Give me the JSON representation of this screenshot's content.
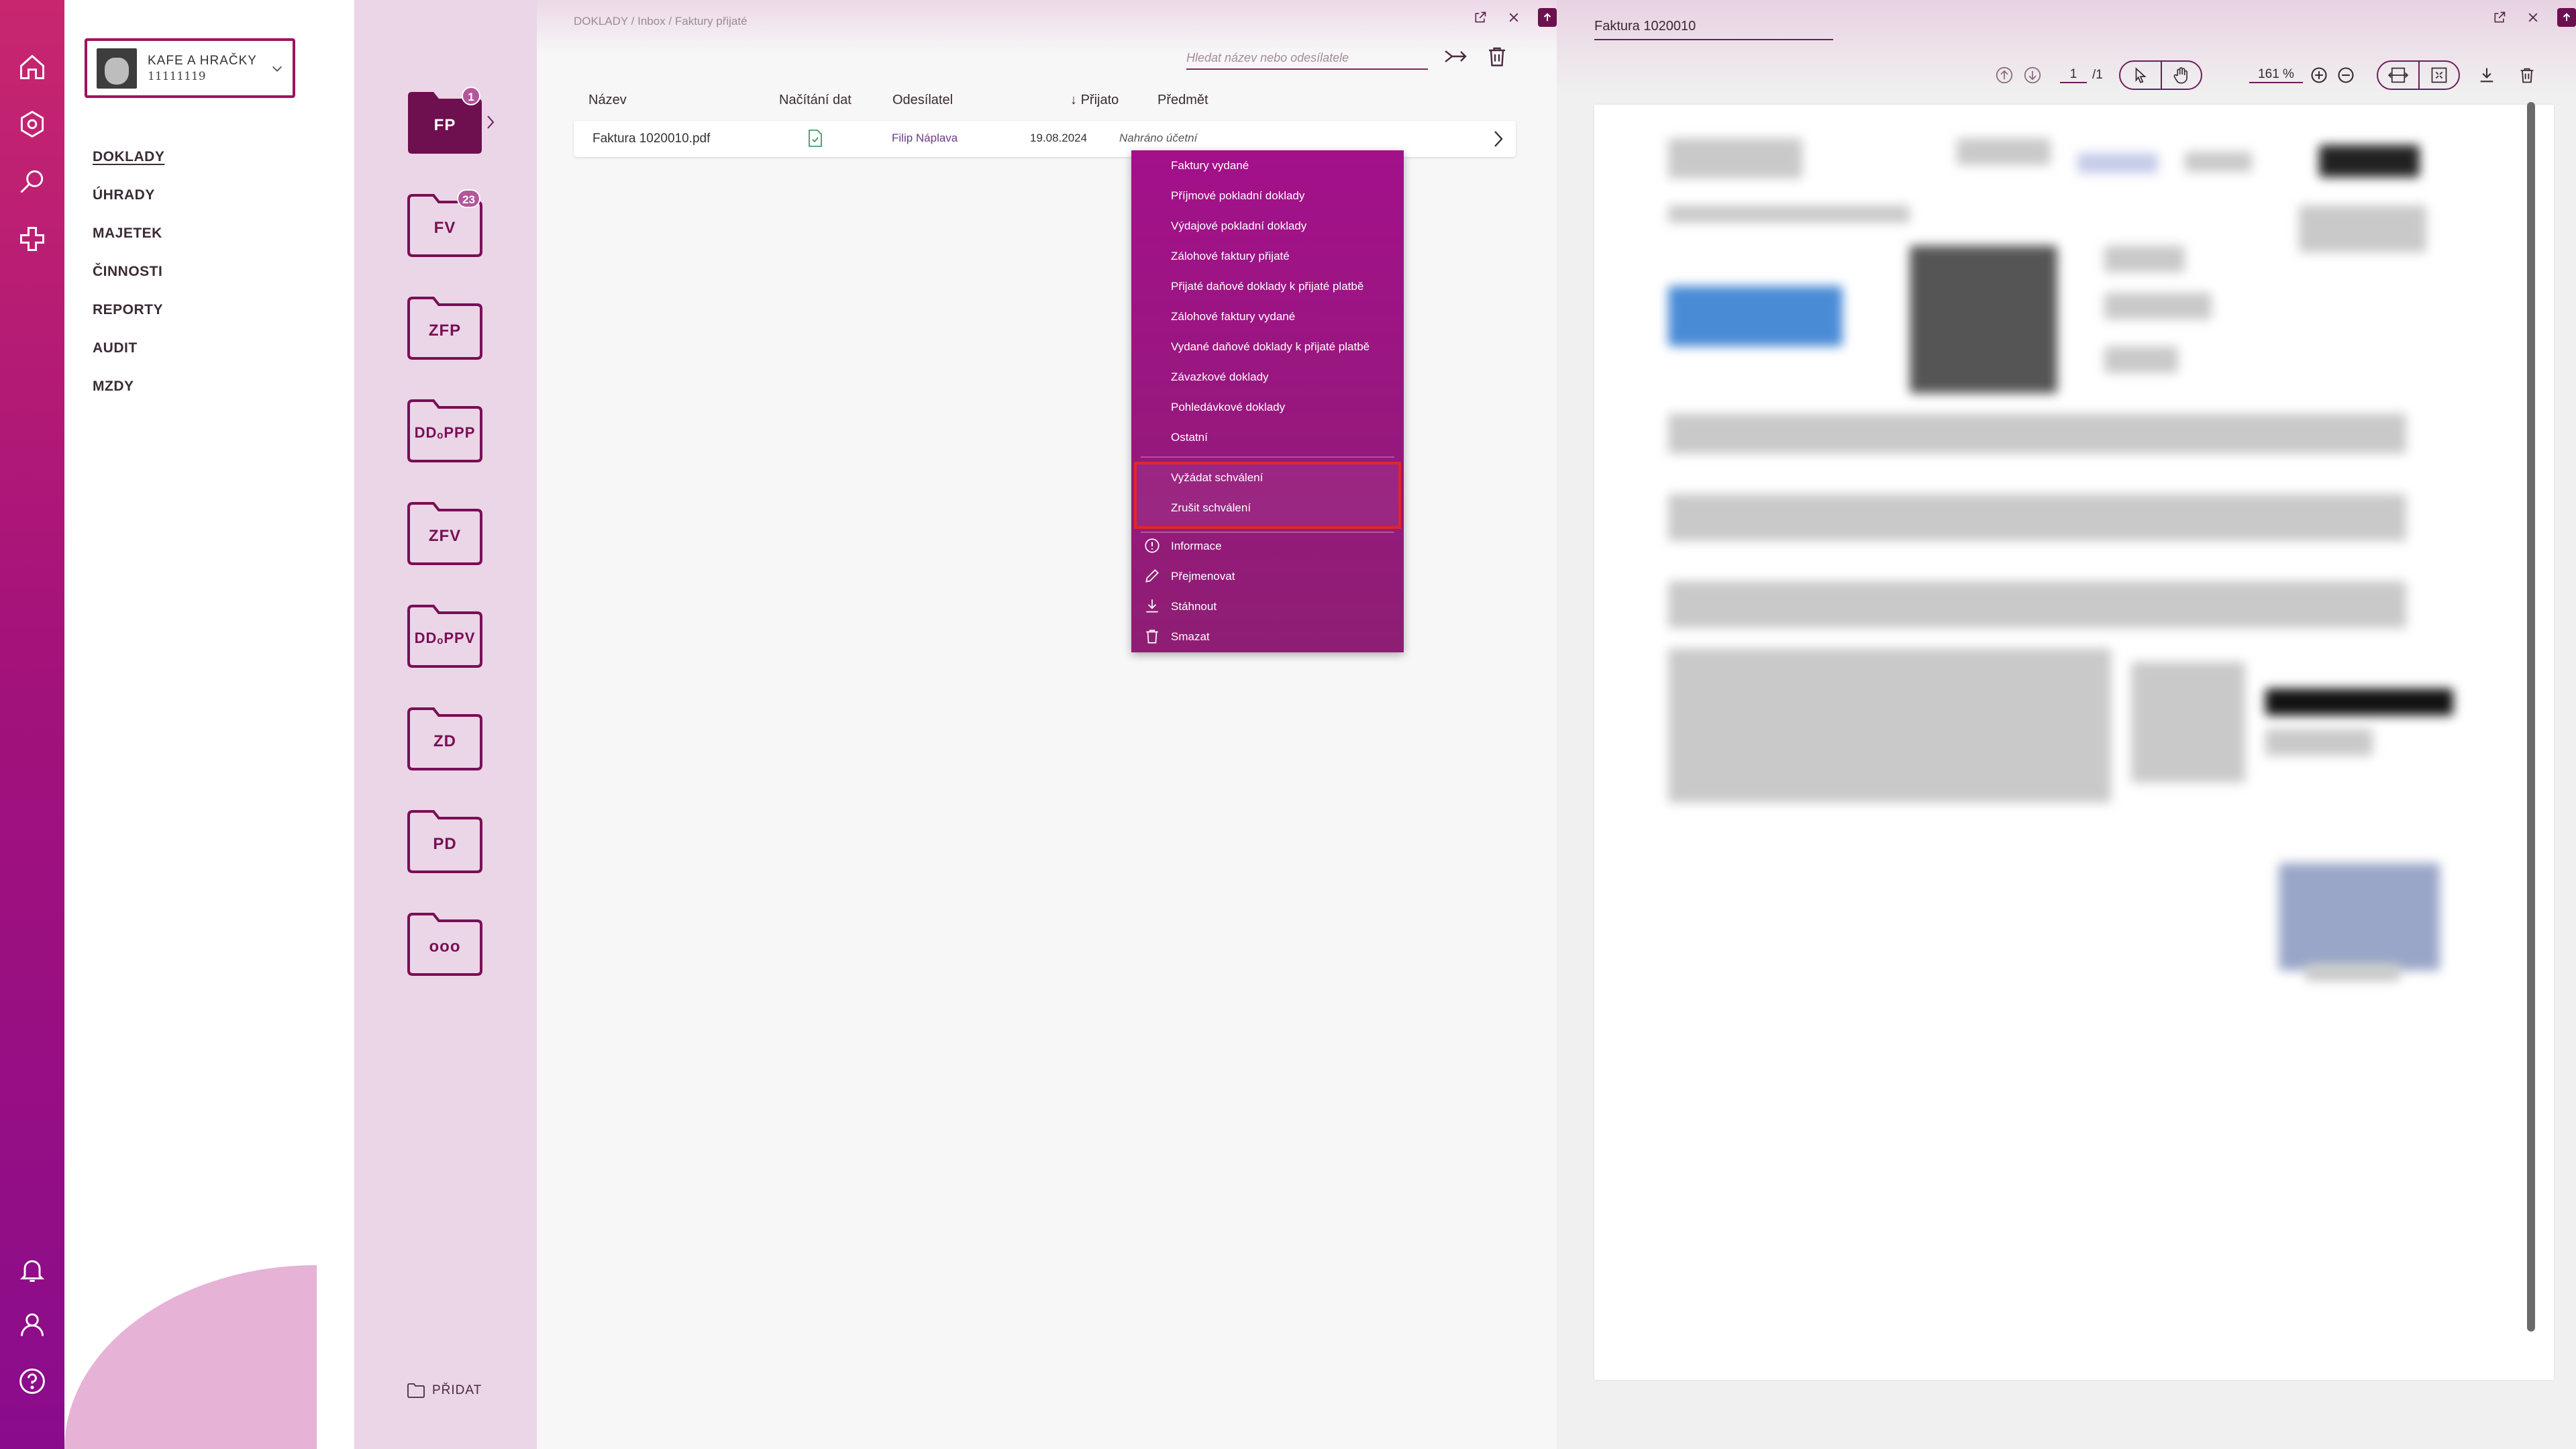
{
  "company": {
    "name": "KAFE A HRAČKY",
    "id": "11111119"
  },
  "nav": [
    "DOKLADY",
    "ÚHRADY",
    "MAJETEK",
    "ČINNOSTI",
    "REPORTY",
    "AUDIT",
    "MZDY"
  ],
  "folders": [
    {
      "label": "FP",
      "badge": "1",
      "active": true
    },
    {
      "label": "FV",
      "badge": "23"
    },
    {
      "label": "ZFP"
    },
    {
      "label": "DDₒPPP"
    },
    {
      "label": "ZFV"
    },
    {
      "label": "DDₒPPV"
    },
    {
      "label": "ZD"
    },
    {
      "label": "PD"
    },
    {
      "label": "ooo"
    }
  ],
  "add_folder_label": "PŘIDAT",
  "breadcrumb": "DOKLADY / Inbox / Faktury přijaté",
  "search": {
    "placeholder": "Hledat název nebo odesílatele"
  },
  "table": {
    "headers": {
      "name": "Název",
      "loading": "Načítání dat",
      "sender": "Odesílatel",
      "received": "Přijato",
      "subject": "Předmět",
      "sort_arrow": "↓"
    },
    "row": {
      "name": "Faktura 1020010.pdf",
      "sender": "Filip Náplava",
      "received": "19.08.2024",
      "subject": "Nahráno účetní"
    }
  },
  "context_menu": {
    "move_items": [
      "Faktury vydané",
      "Příjmové pokladní doklady",
      "Výdajové pokladní doklady",
      "Zálohové faktury přijaté",
      "Přijaté daňové doklady k přijaté platbě",
      "Zálohové faktury vydané",
      "Vydané daňové doklady k přijaté platbě",
      "Závazkové doklady",
      "Pohledávkové doklady",
      "Ostatní"
    ],
    "approval_items": [
      "Vyžádat schválení",
      "Zrušit schválení"
    ],
    "action_items": [
      "Informace",
      "Přejmenovat",
      "Stáhnout",
      "Smazat"
    ]
  },
  "viewer": {
    "title": "Faktura 1020010",
    "page_current": "1",
    "page_total": "/1",
    "zoom": "161 %"
  },
  "colors": {
    "accent": "#a1125c",
    "rail": "#a4127a",
    "menu": "#9a137f",
    "highlight": "#e0262d"
  }
}
